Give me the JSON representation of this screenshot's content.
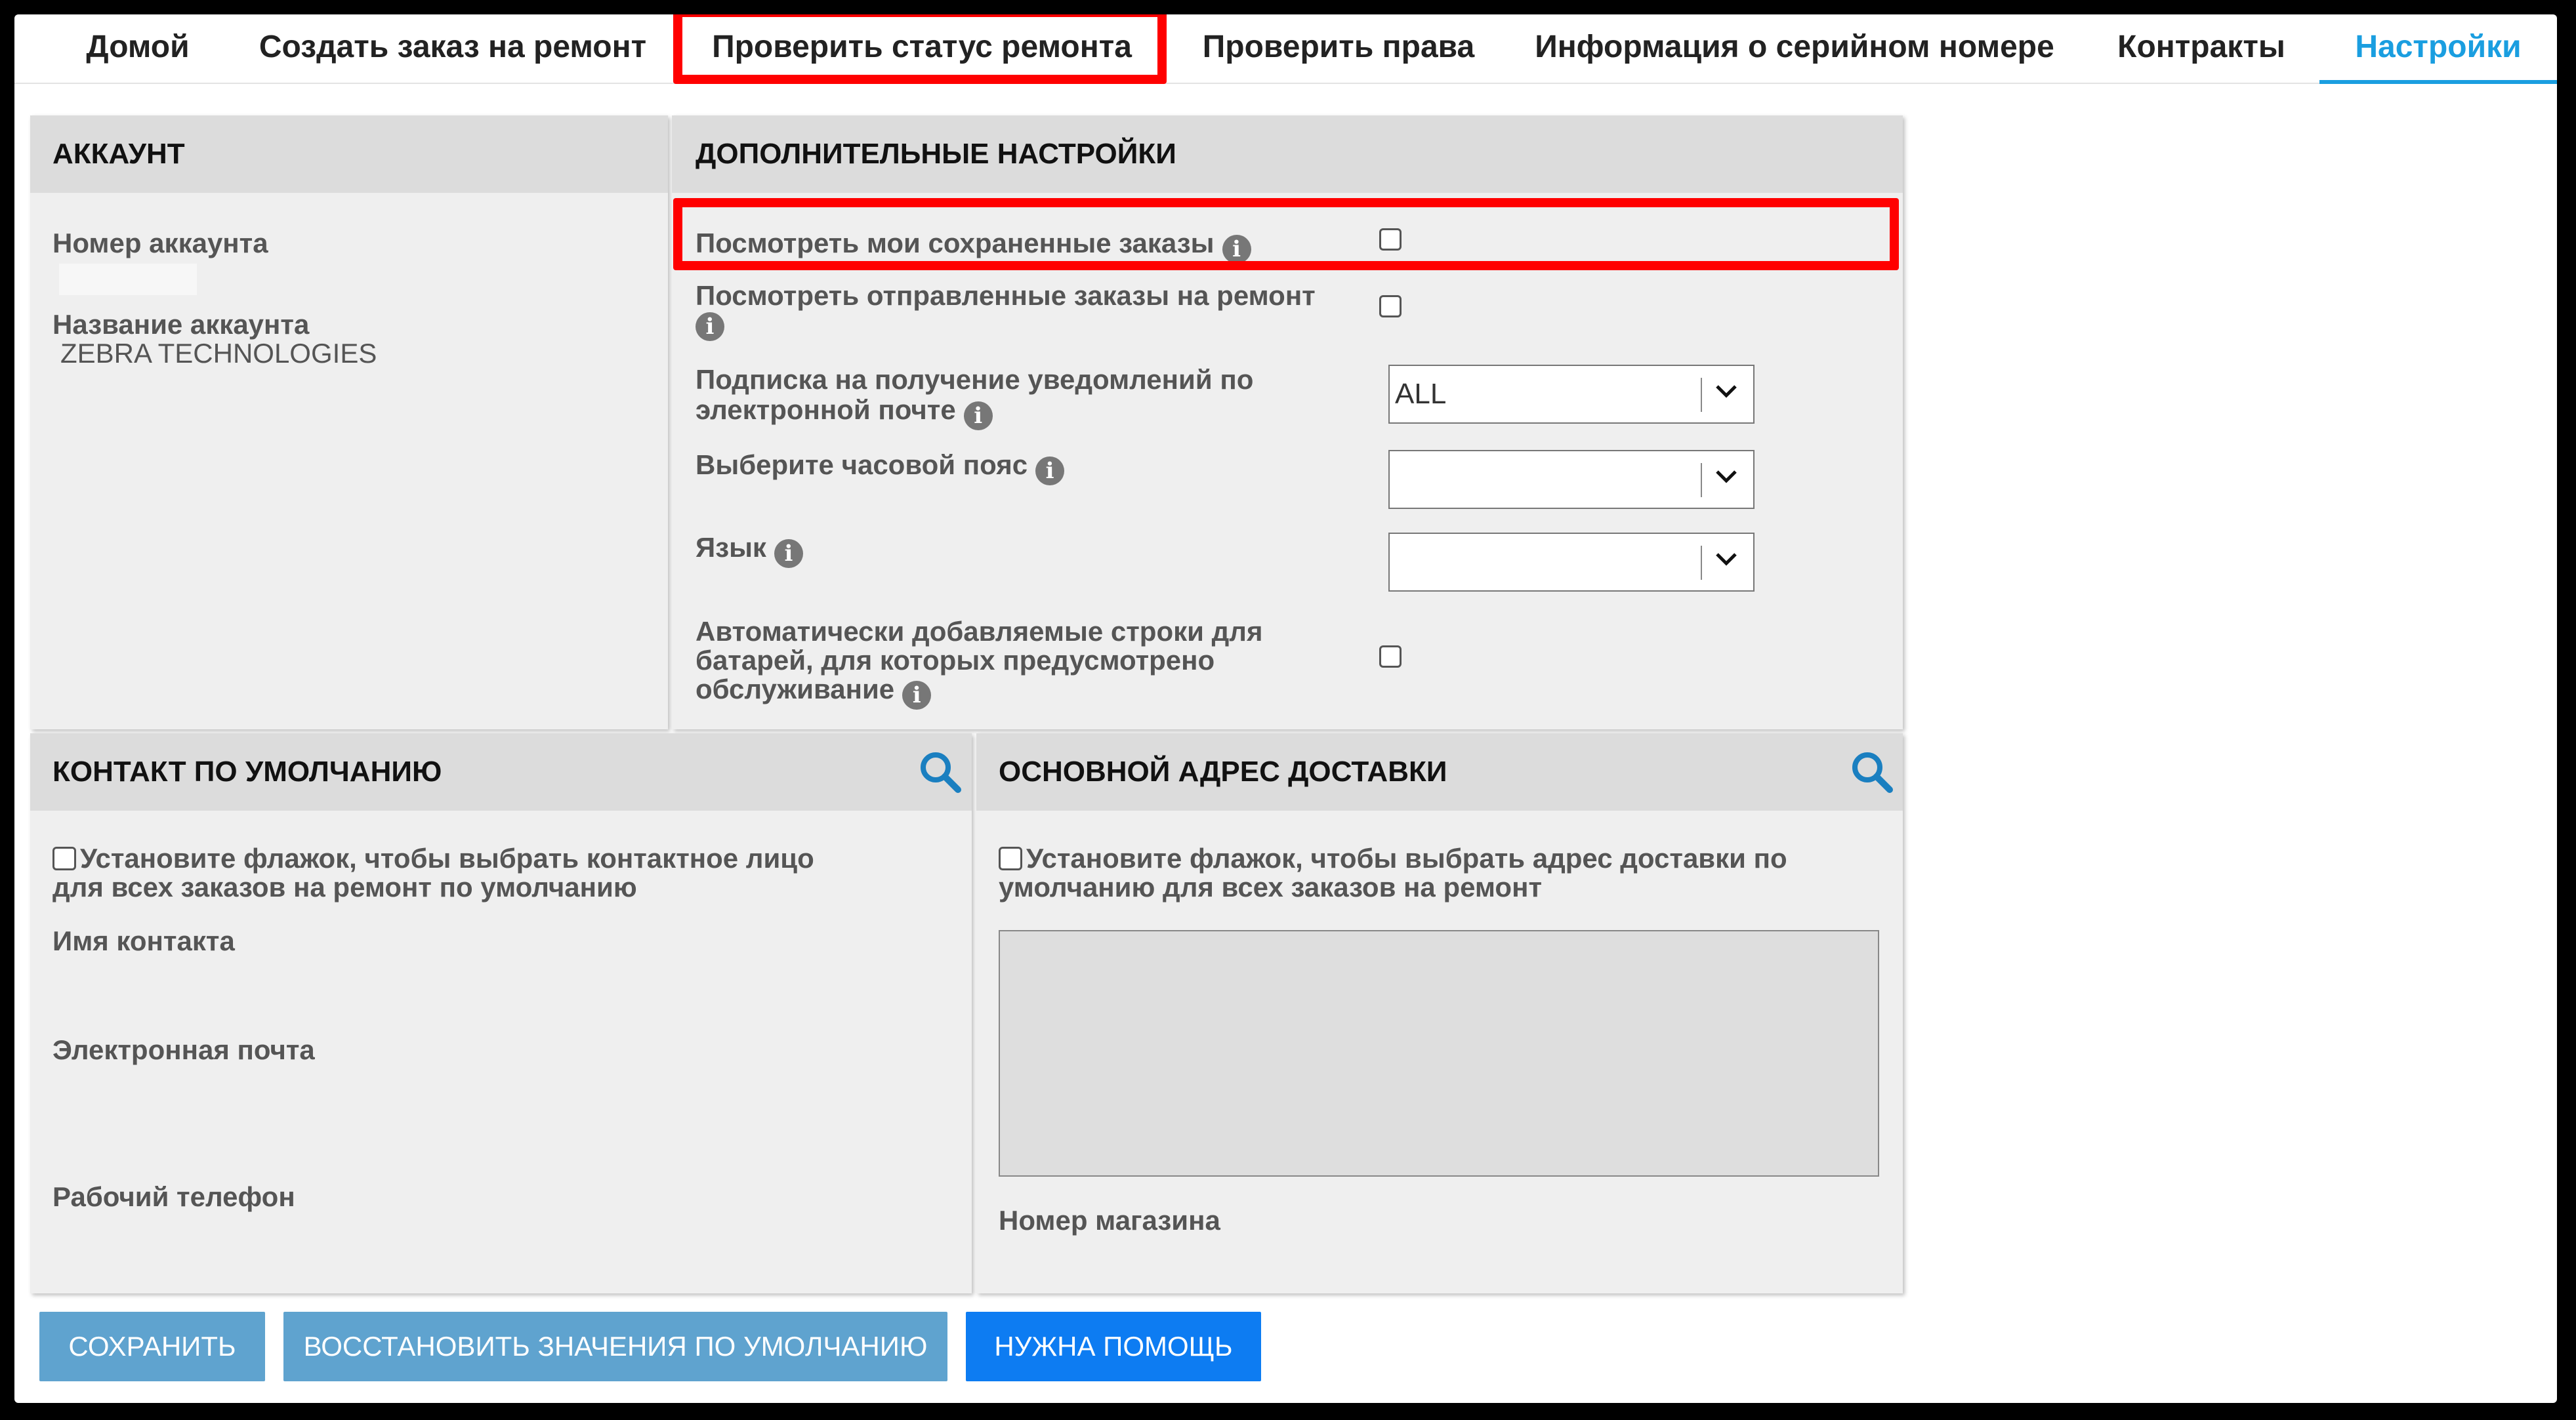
{
  "nav": {
    "items": [
      {
        "label": "Домой"
      },
      {
        "label": "Создать заказ на ремонт"
      },
      {
        "label": "Проверить статус ремонта"
      },
      {
        "label": "Проверить права"
      },
      {
        "label": "Информация о серийном номере"
      },
      {
        "label": "Контракты"
      },
      {
        "label": "Настройки"
      }
    ],
    "active": "Настройки"
  },
  "account": {
    "title": "АККАУНТ",
    "number_label": "Номер аккаунта",
    "number_value": "",
    "name_label": "Название аккаунта",
    "name_value": "ZEBRA TECHNOLOGIES"
  },
  "advanced": {
    "title": "ДОПОЛНИТЕЛЬНЫЕ НАСТРОЙКИ",
    "saved_orders_label": "Посмотреть мои сохраненные заказы",
    "saved_orders_checked": false,
    "sent_orders_label": "Посмотреть отправленные заказы на ремонт",
    "sent_orders_checked": false,
    "email_sub_label_1": "Подписка на получение уведомлений по",
    "email_sub_label_2": "электронной почте",
    "email_sub_value": "ALL",
    "timezone_label": "Выберите часовой пояс",
    "timezone_value": "",
    "language_label": "Язык",
    "language_value": "",
    "battery_label_1": "Автоматически добавляемые строки для",
    "battery_label_2": "батарей, для которых предусмотрено",
    "battery_label_3": "обслуживание",
    "battery_checked": false
  },
  "contact": {
    "title": "КОНТАКТ ПО УМОЛЧАНИЮ",
    "checkbox_label_1": "Установите флажок, чтобы выбрать контактное лицо",
    "checkbox_label_2": "для всех заказов на ремонт по умолчанию",
    "name_label": "Имя контакта",
    "email_label": "Электронная почта",
    "phone_label": "Рабочий телефон"
  },
  "shipping": {
    "title": "ОСНОВНОЙ АДРЕС ДОСТАВКИ",
    "checkbox_label_1": "Установите флажок, чтобы  выбрать адрес доставки по",
    "checkbox_label_2": "умолчанию для всех заказов на ремонт",
    "address_value": "",
    "store_label": "Номер магазина"
  },
  "buttons": {
    "save": "СОХРАНИТЬ",
    "restore": "ВОССТАНОВИТЬ ЗНАЧЕНИЯ ПО УМОЛЧАНИЮ",
    "help": "НУЖНА ПОМОЩЬ"
  },
  "colors": {
    "accent": "#1a9ee0",
    "highlight": "#ff0000",
    "primary_button": "#0d7cf2",
    "muted_button": "#5fa3cf"
  }
}
